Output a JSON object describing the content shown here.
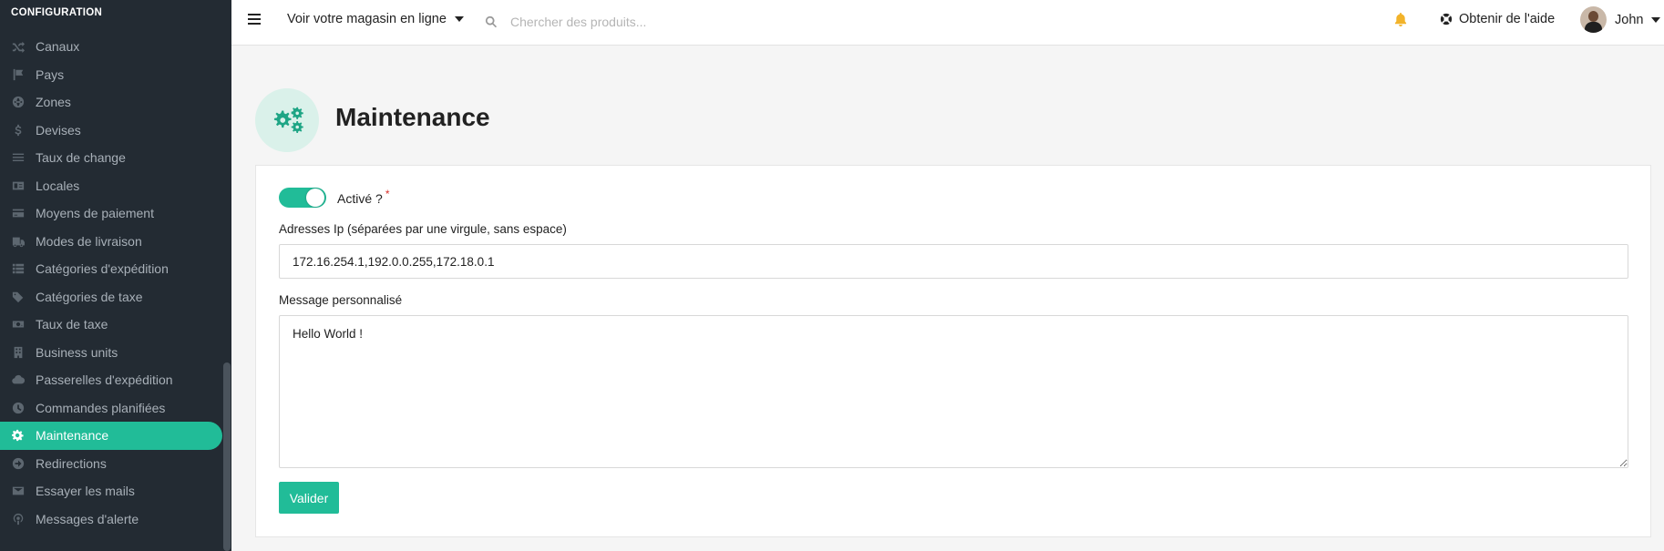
{
  "sidebar": {
    "heading": "CONFIGURATION",
    "items": [
      {
        "label": "Canaux",
        "icon": "shuffle-icon"
      },
      {
        "label": "Pays",
        "icon": "flag-icon"
      },
      {
        "label": "Zones",
        "icon": "globe-icon"
      },
      {
        "label": "Devises",
        "icon": "dollar-icon"
      },
      {
        "label": "Taux de change",
        "icon": "bars-icon"
      },
      {
        "label": "Locales",
        "icon": "language-icon"
      },
      {
        "label": "Moyens de paiement",
        "icon": "credit-card-icon"
      },
      {
        "label": "Modes de livraison",
        "icon": "truck-icon"
      },
      {
        "label": "Catégories d'expédition",
        "icon": "list-icon"
      },
      {
        "label": "Catégories de taxe",
        "icon": "tags-icon"
      },
      {
        "label": "Taux de taxe",
        "icon": "money-icon"
      },
      {
        "label": "Business units",
        "icon": "building-icon"
      },
      {
        "label": "Passerelles d'expédition",
        "icon": "cloud-icon"
      },
      {
        "label": "Commandes planifiées",
        "icon": "clock-icon"
      },
      {
        "label": "Maintenance",
        "icon": "cogs-icon",
        "active": true
      },
      {
        "label": "Redirections",
        "icon": "arrow-circle-icon"
      },
      {
        "label": "Essayer les mails",
        "icon": "envelope-icon"
      },
      {
        "label": "Messages d'alerte",
        "icon": "podcast-icon"
      }
    ]
  },
  "topbar": {
    "store_link": "Voir votre magasin en ligne",
    "search_placeholder": "Chercher des produits...",
    "help_label": "Obtenir de l'aide",
    "user_name": "John"
  },
  "page": {
    "title": "Maintenance",
    "icon": "cogs-icon"
  },
  "form": {
    "enabled_label": "Activé ?",
    "enabled_required": "*",
    "enabled": true,
    "ip_label": "Adresses Ip (séparées par une virgule, sans espace)",
    "ip_value": "172.16.254.1,192.0.0.255,172.18.0.1",
    "message_label": "Message personnalisé",
    "message_value": "Hello World !",
    "submit_label": "Valider"
  },
  "colors": {
    "accent": "#21bc98",
    "sidebar_bg": "#232b33",
    "bell": "#f2b32a"
  }
}
